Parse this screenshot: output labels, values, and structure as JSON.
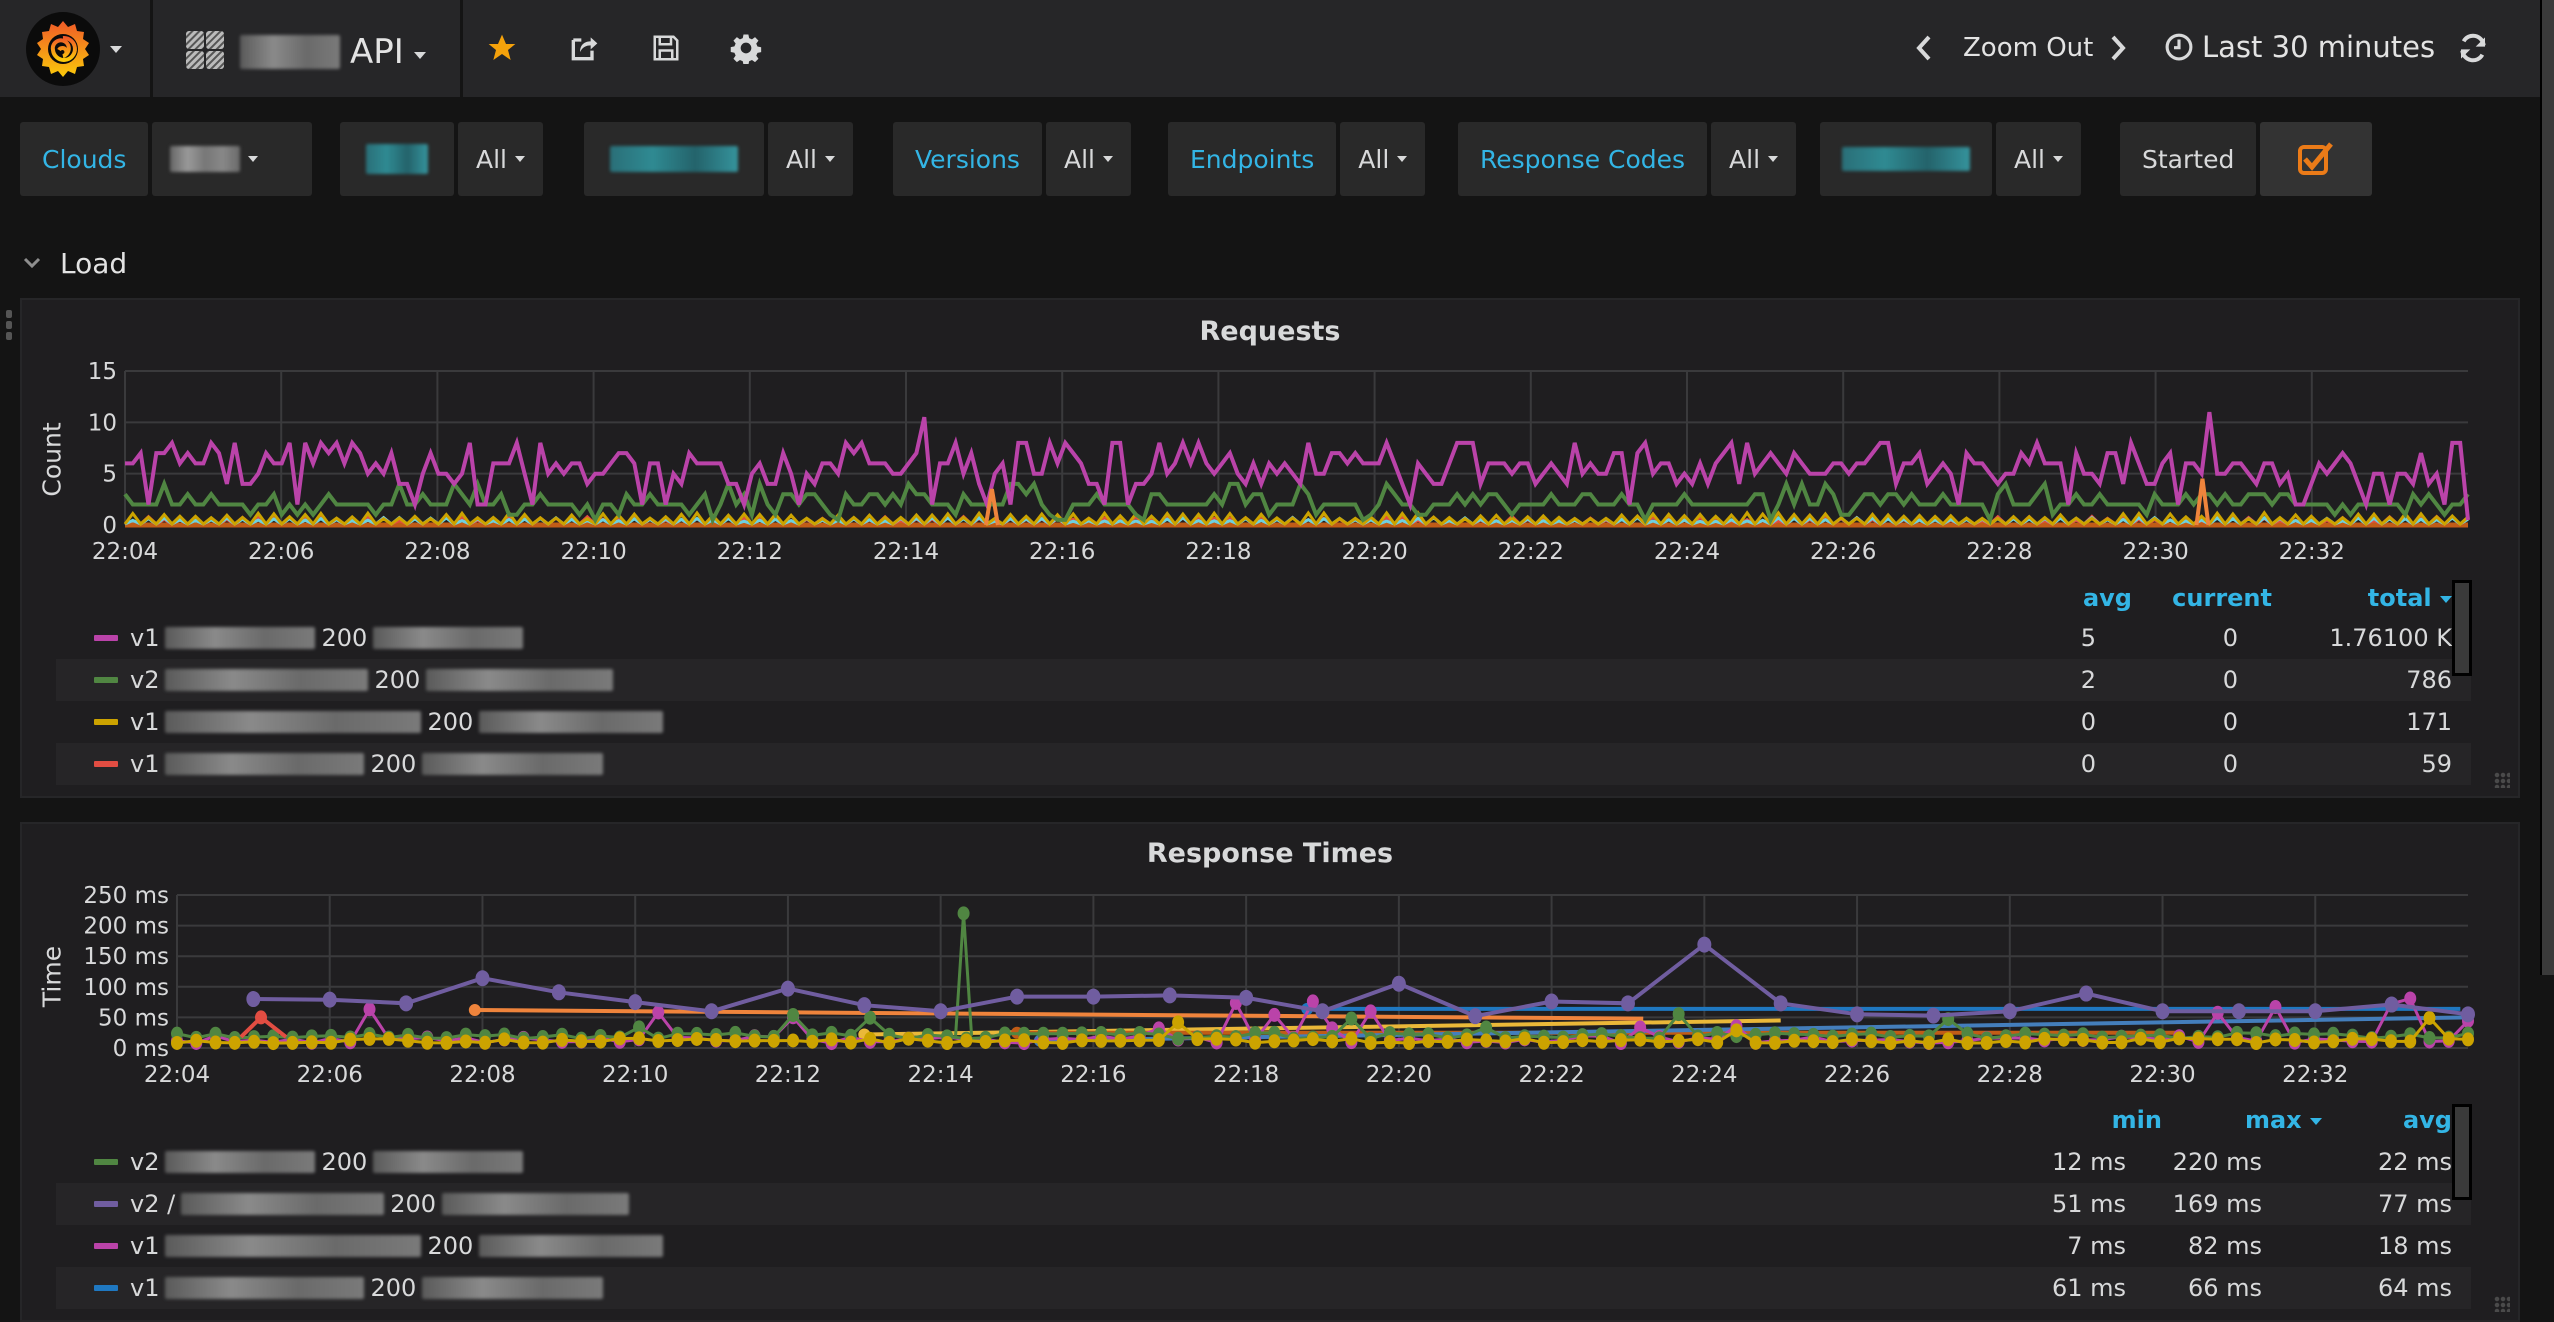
{
  "navbar": {
    "dashboard_title": "API",
    "zoom_out_label": "Zoom Out",
    "time_range_label": "Last 30 minutes",
    "icons": [
      "grafana-logo",
      "dashboard-grid-icon",
      "star-icon",
      "share-icon",
      "save-icon",
      "gear-icon",
      "chevron-left-icon",
      "chevron-right-icon",
      "clock-icon",
      "refresh-icon"
    ],
    "star_color": "#f5a20b"
  },
  "filters": [
    {
      "label": "Clouds",
      "value": "",
      "label_redacted": false,
      "value_redacted": true
    },
    {
      "label": "",
      "value": "All",
      "label_redacted": true,
      "value_redacted": false
    },
    {
      "label": "",
      "value": "All",
      "label_redacted": true,
      "value_redacted": false
    },
    {
      "label": "Versions",
      "value": "All",
      "label_redacted": false,
      "value_redacted": false
    },
    {
      "label": "Endpoints",
      "value": "All",
      "label_redacted": false,
      "value_redacted": false
    },
    {
      "label": "Response Codes",
      "value": "All",
      "label_redacted": false,
      "value_redacted": false
    },
    {
      "label": "",
      "value": "All",
      "label_redacted": true,
      "value_redacted": false
    }
  ],
  "started_toggle": {
    "label": "Started",
    "checked": true,
    "color": "#eb7b18"
  },
  "row": {
    "title": "Load"
  },
  "colors": {
    "accent": "#33b5e5",
    "pink": "#ba43a9",
    "green": "#508642",
    "yellow": "#cca300",
    "red": "#e24d42",
    "purple": "#705da0",
    "blue": "#1f78c1",
    "orange": "#ef843c",
    "dkorange": "#c15c17",
    "cyan": "#6ed0e0",
    "lgreen": "#7eb26d"
  },
  "chart_data": [
    {
      "type": "line",
      "title": "Requests",
      "xlabel": "",
      "ylabel": "Count",
      "ylim": [
        0,
        15
      ],
      "yticks": [
        "15",
        "10",
        "5",
        "0"
      ],
      "xticks": [
        "22:04",
        "22:06",
        "22:08",
        "22:10",
        "22:12",
        "22:14",
        "22:16",
        "22:18",
        "22:20",
        "22:22",
        "22:24",
        "22:26",
        "22:28",
        "22:30",
        "22:32"
      ],
      "grid": true,
      "legend_placement": "bottom",
      "legend_columns": [
        "avg",
        "current",
        "total"
      ],
      "legend_sort": "total",
      "series": [
        {
          "name": "v1 [redacted] 200 [redacted]",
          "prefix": "v1",
          "code": "200",
          "color": "#ba43a9",
          "avg": "5",
          "current": "0",
          "total": "1.76100 K",
          "approx_level": 5,
          "approx_range": [
            2,
            10
          ]
        },
        {
          "name": "v2 [redacted] 200 [redacted]",
          "prefix": "v2",
          "code": "200",
          "color": "#508642",
          "avg": "2",
          "current": "0",
          "total": "786",
          "approx_level": 2,
          "approx_range": [
            0,
            4
          ]
        },
        {
          "name": "v1 [redacted] 200 [redacted]",
          "prefix": "v1",
          "code": "200",
          "color": "#cca300",
          "avg": "0",
          "current": "0",
          "total": "171",
          "approx_level": 0.5,
          "approx_range": [
            0,
            1
          ]
        },
        {
          "name": "v1 [redacted] 200 [redacted]",
          "prefix": "v1",
          "code": "200",
          "color": "#e24d42",
          "avg": "0",
          "current": "0",
          "total": "59",
          "approx_level": 0.2,
          "approx_range": [
            0,
            1
          ]
        }
      ]
    },
    {
      "type": "line",
      "title": "Response Times",
      "xlabel": "",
      "ylabel": "Time",
      "ylim": [
        0,
        250
      ],
      "yticks": [
        "250 ms",
        "200 ms",
        "150 ms",
        "100 ms",
        "50 ms",
        "0 ms"
      ],
      "xticks": [
        "22:04",
        "22:06",
        "22:08",
        "22:10",
        "22:12",
        "22:14",
        "22:16",
        "22:18",
        "22:20",
        "22:22",
        "22:24",
        "22:26",
        "22:28",
        "22:30",
        "22:32"
      ],
      "grid": true,
      "legend_placement": "bottom",
      "legend_columns": [
        "min",
        "max",
        "avg"
      ],
      "legend_sort": "max",
      "series": [
        {
          "name": "v2 [redacted] 200 [redacted]",
          "prefix": "v2",
          "code": "200",
          "color": "#508642",
          "min": "12 ms",
          "max": "220 ms",
          "avg": "22 ms"
        },
        {
          "name": "v2 [redacted] 200 [redacted]",
          "prefix": "v2 /",
          "code": "200",
          "color": "#705da0",
          "min": "51 ms",
          "max": "169 ms",
          "avg": "77 ms",
          "points": [
            [
              5,
              80
            ],
            [
              6,
              79
            ],
            [
              7,
              73
            ],
            [
              8,
              114
            ],
            [
              9,
              91
            ],
            [
              10,
              75
            ],
            [
              11,
              60
            ],
            [
              12,
              97
            ],
            [
              13,
              70
            ],
            [
              14,
              60
            ],
            [
              15,
              84
            ],
            [
              16,
              84
            ],
            [
              17,
              86
            ],
            [
              18,
              82
            ],
            [
              19,
              60
            ],
            [
              20,
              105
            ],
            [
              21,
              52
            ],
            [
              22,
              76
            ],
            [
              23,
              73
            ],
            [
              24,
              169
            ],
            [
              25,
              73
            ],
            [
              26,
              55
            ],
            [
              27,
              53
            ],
            [
              28,
              60
            ],
            [
              29,
              89
            ],
            [
              30,
              60
            ],
            [
              31,
              60
            ],
            [
              32,
              60
            ],
            [
              33,
              71
            ],
            [
              34,
              55
            ]
          ]
        },
        {
          "name": "v1 [redacted] 200 [redacted]",
          "prefix": "v1",
          "code": "200",
          "color": "#ba43a9",
          "min": "7 ms",
          "max": "82 ms",
          "avg": "18 ms"
        },
        {
          "name": "v1 [redacted] 200 [redacted]",
          "prefix": "v1",
          "code": "200",
          "color": "#1f78c1",
          "min": "61 ms",
          "max": "66 ms",
          "avg": "64 ms"
        }
      ]
    }
  ]
}
